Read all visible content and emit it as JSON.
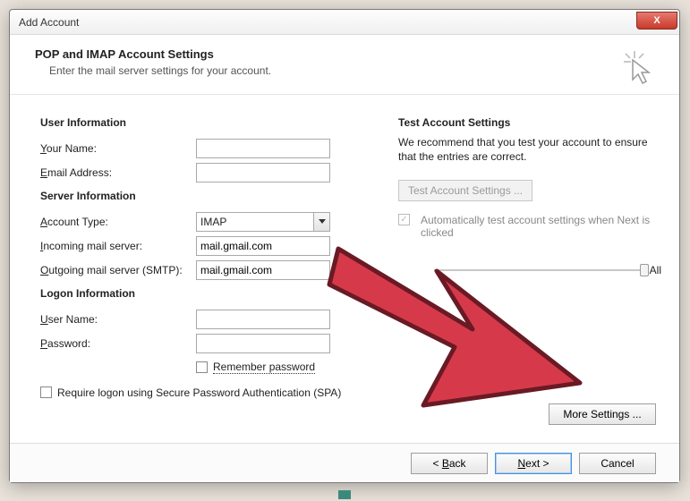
{
  "window": {
    "title": "Add Account",
    "close_glyph": "X"
  },
  "banner": {
    "title": "POP and IMAP Account Settings",
    "subtitle": "Enter the mail server settings for your account."
  },
  "sections": {
    "user_info": "User Information",
    "server_info": "Server Information",
    "logon_info": "Logon Information",
    "test": "Test Account Settings"
  },
  "fields": {
    "your_name": {
      "label_pre": "",
      "label_u": "Y",
      "label_post": "our Name:",
      "value": ""
    },
    "email": {
      "label_pre": "",
      "label_u": "E",
      "label_post": "mail Address:",
      "value": ""
    },
    "account_type": {
      "label_pre": "",
      "label_u": "A",
      "label_post": "ccount Type:",
      "value": "IMAP"
    },
    "incoming": {
      "label_pre": "",
      "label_u": "I",
      "label_post": "ncoming mail server:",
      "value": "mail.gmail.com"
    },
    "outgoing": {
      "label_pre": "",
      "label_u": "O",
      "label_post": "utgoing mail server (SMTP):",
      "value": "mail.gmail.com"
    },
    "user_name": {
      "label_pre": "",
      "label_u": "U",
      "label_post": "ser Name:",
      "value": ""
    },
    "password": {
      "label_pre": "",
      "label_u": "P",
      "label_post": "assword:",
      "value": ""
    }
  },
  "checkboxes": {
    "remember": {
      "label_u": "R",
      "label_post": "emember password",
      "checked": false
    },
    "spa": {
      "label_pre": "Re",
      "label_u": "q",
      "label_post": "uire logon using Secure Password Authentication (SPA)",
      "checked": false
    },
    "auto_test": {
      "label_pre": "Automatically test account ",
      "label_u": "s",
      "label_post": "ettings when Next is clicked",
      "checked": true
    }
  },
  "test_panel": {
    "blurb": "We recommend that you test your account to ensure that the entries are correct.",
    "button_pre": "",
    "button_u": "T",
    "button_post": "est Account Settings ..."
  },
  "slider": {
    "label_right": "All"
  },
  "buttons": {
    "more_pre": "",
    "more_u": "M",
    "more_post": "ore Settings ...",
    "back_pre": "< ",
    "back_u": "B",
    "back_post": "ack",
    "next_pre": "",
    "next_u": "N",
    "next_post": "ext >",
    "cancel": "Cancel"
  }
}
